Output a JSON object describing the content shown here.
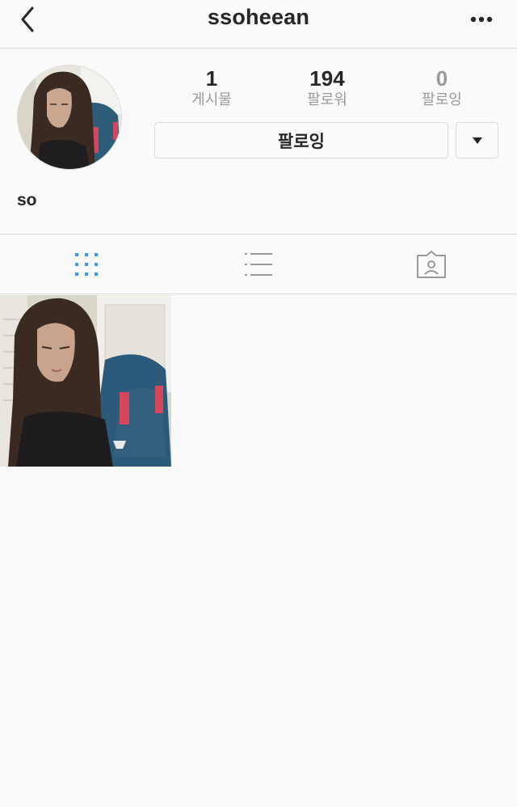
{
  "header": {
    "username": "ssoheean"
  },
  "stats": [
    {
      "value": "1",
      "label": "게시물"
    },
    {
      "value": "194",
      "label": "팔로워"
    },
    {
      "value": "0",
      "label": "팔로잉"
    }
  ],
  "actions": {
    "follow_label": "팔로잉"
  },
  "bio": {
    "name": "so"
  },
  "tabs": [
    {
      "icon": "grid-icon",
      "active": true
    },
    {
      "icon": "list-icon",
      "active": false
    },
    {
      "icon": "tagged-icon",
      "active": false
    }
  ],
  "colors": {
    "accent": "#3897f0",
    "text": "#262626",
    "muted": "#999999",
    "border": "#dbdbdb",
    "background": "#fafafa"
  },
  "posts": [
    {
      "type": "photo"
    }
  ]
}
